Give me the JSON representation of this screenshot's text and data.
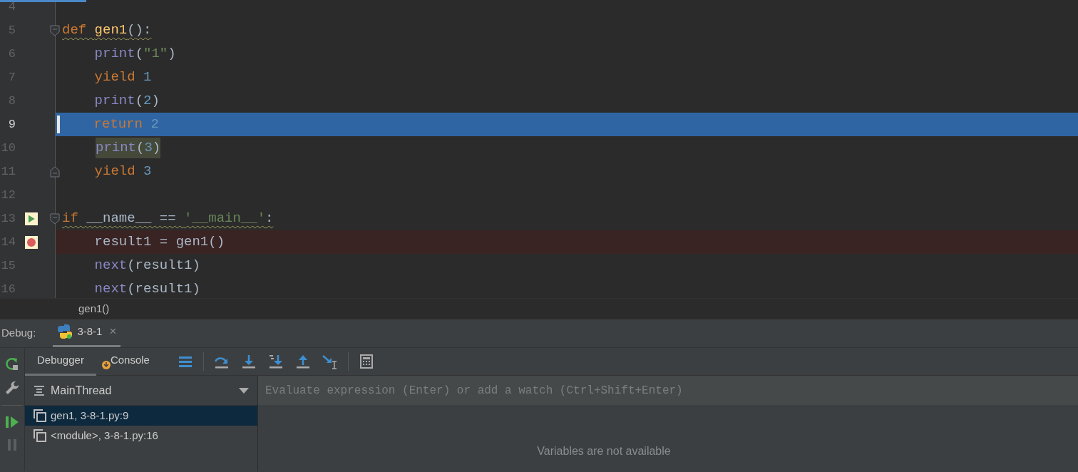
{
  "editor": {
    "lines": [
      {
        "number": "4"
      },
      {
        "number": "5",
        "fold_start": true,
        "warning": true,
        "tokens": [
          {
            "text": "def ",
            "kind": "keyword"
          },
          {
            "text": "gen1",
            "kind": "function"
          },
          {
            "text": "():",
            "kind": "plain"
          }
        ]
      },
      {
        "number": "6",
        "tokens": [
          {
            "text": "    print",
            "kind": "builtin"
          },
          {
            "text": "(",
            "kind": "plain"
          },
          {
            "text": "\"1\"",
            "kind": "string"
          },
          {
            "text": ")",
            "kind": "plain"
          }
        ]
      },
      {
        "number": "7",
        "tokens": [
          {
            "text": "    yield ",
            "kind": "keyword"
          },
          {
            "text": "1",
            "kind": "number"
          }
        ]
      },
      {
        "number": "8",
        "tokens": [
          {
            "text": "    print",
            "kind": "builtin"
          },
          {
            "text": "(",
            "kind": "plain"
          },
          {
            "text": "2",
            "kind": "number"
          },
          {
            "text": ")",
            "kind": "plain"
          }
        ]
      },
      {
        "number": "9",
        "execution_point": true,
        "tokens": [
          {
            "text": "    return ",
            "kind": "keyword"
          },
          {
            "text": "2",
            "kind": "number"
          }
        ]
      },
      {
        "number": "10",
        "step_target": true,
        "tokens": [
          {
            "text": "print",
            "kind": "builtin"
          },
          {
            "text": "(",
            "kind": "plain"
          },
          {
            "text": "3",
            "kind": "number"
          },
          {
            "text": ")",
            "kind": "plain"
          }
        ]
      },
      {
        "number": "11",
        "fold_end": true,
        "tokens": [
          {
            "text": "    yield ",
            "kind": "keyword"
          },
          {
            "text": "3",
            "kind": "number"
          }
        ]
      },
      {
        "number": "12"
      },
      {
        "number": "13",
        "run_marker": true,
        "fold_start": true,
        "warning": true,
        "tokens": [
          {
            "text": "if ",
            "kind": "keyword"
          },
          {
            "text": "__name__ == ",
            "kind": "plain"
          },
          {
            "text": "'__main__'",
            "kind": "string"
          },
          {
            "text": ":",
            "kind": "plain"
          }
        ]
      },
      {
        "number": "14",
        "breakpoint": true,
        "tokens": [
          {
            "text": "    result1 = gen1()",
            "kind": "plain"
          }
        ]
      },
      {
        "number": "15",
        "tokens": [
          {
            "text": "    next",
            "kind": "builtin"
          },
          {
            "text": "(result1)",
            "kind": "plain"
          }
        ]
      },
      {
        "number": "16",
        "tokens": [
          {
            "text": "    next",
            "kind": "builtin"
          },
          {
            "text": "(result1)",
            "kind": "plain"
          }
        ]
      }
    ]
  },
  "breadcrumb": "gen1()",
  "debug": {
    "label": "Debug:",
    "session": {
      "label": "3-8-1",
      "close": "×",
      "selected": true
    },
    "tabs": [
      {
        "label": "Debugger",
        "selected": true
      },
      {
        "label": "Console",
        "selected": false
      }
    ],
    "thread": "MainThread",
    "frames": [
      {
        "text": "gen1, 3-8-1.py:9",
        "selected": true
      },
      {
        "text": "<module>, 3-8-1.py:16",
        "selected": false
      }
    ],
    "evaluate": {
      "placeholder": "Evaluate expression (Enter) or add a watch (Ctrl+Shift+Enter)"
    },
    "variables_message": "Variables are not available"
  }
}
